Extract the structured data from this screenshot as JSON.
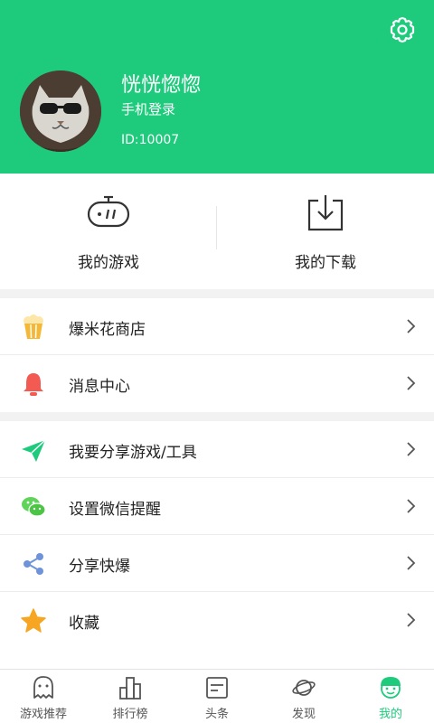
{
  "profile": {
    "username": "恍恍惚惚",
    "login_type": "手机登录",
    "user_id": "ID:10007"
  },
  "shortcuts": [
    {
      "label": "我的游戏",
      "icon": "gamepad-icon"
    },
    {
      "label": "我的下载",
      "icon": "download-icon"
    }
  ],
  "menu_group_1": [
    {
      "label": "爆米花商店",
      "icon": "popcorn-icon"
    },
    {
      "label": "消息中心",
      "icon": "bell-icon"
    }
  ],
  "menu_group_2": [
    {
      "label": "我要分享游戏/工具",
      "icon": "paper-plane-icon"
    },
    {
      "label": "设置微信提醒",
      "icon": "wechat-icon"
    },
    {
      "label": "分享快爆",
      "icon": "share-icon"
    },
    {
      "label": "收藏",
      "icon": "star-icon"
    }
  ],
  "tabs": [
    {
      "label": "游戏推荐",
      "icon": "game-face-icon"
    },
    {
      "label": "排行榜",
      "icon": "ranking-icon"
    },
    {
      "label": "头条",
      "icon": "news-icon"
    },
    {
      "label": "发现",
      "icon": "planet-icon"
    },
    {
      "label": "我的",
      "icon": "profile-face-icon",
      "active": true
    }
  ],
  "colors": {
    "brand": "#1ecb7c",
    "bell": "#f25a52",
    "popcorn": "#f5b836",
    "share": "#6f93d8",
    "star": "#f6a623"
  }
}
